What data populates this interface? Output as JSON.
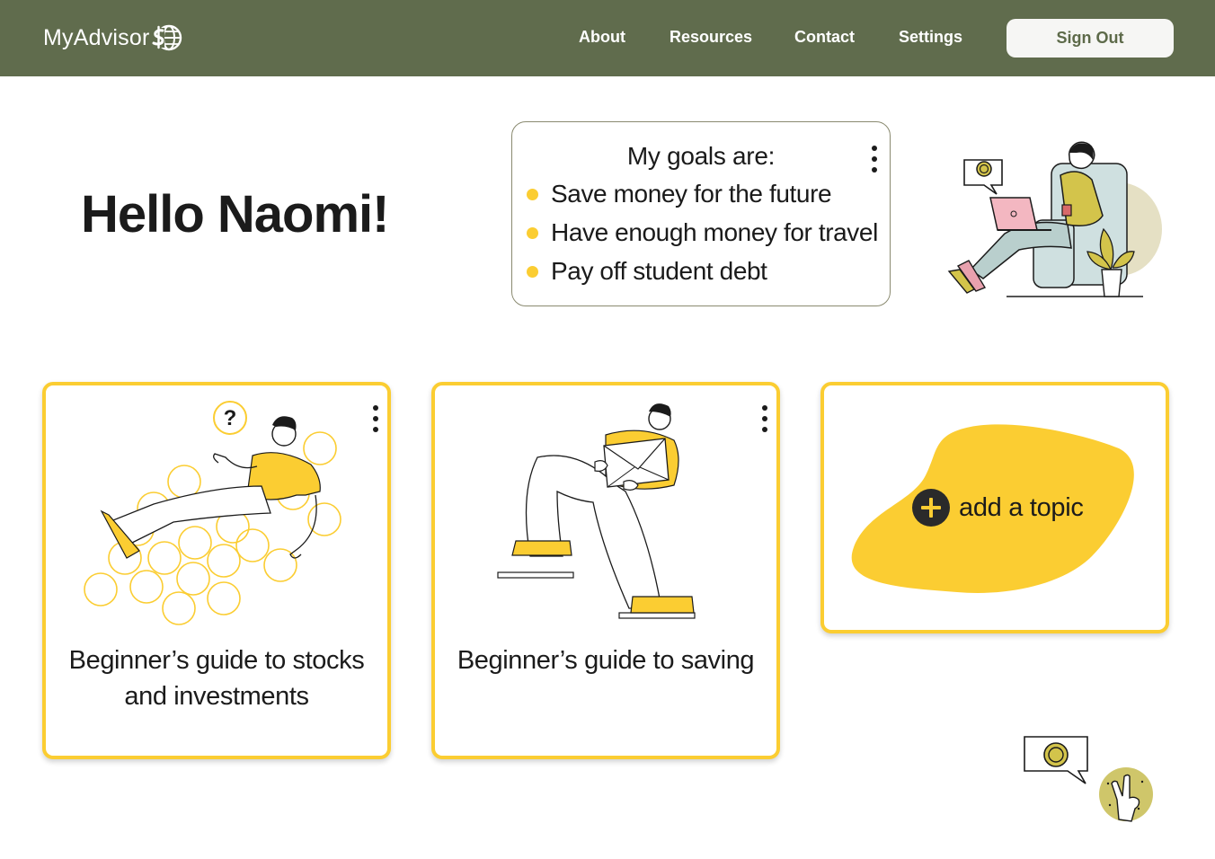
{
  "header": {
    "brand": "MyAdvisor",
    "nav": [
      "About",
      "Resources",
      "Contact",
      "Settings"
    ],
    "sign_out": "Sign Out"
  },
  "greeting": "Hello Naomi!",
  "goals": {
    "title": "My goals are:",
    "items": [
      "Save money for the future",
      "Have enough money for travel",
      "Pay off student debt"
    ]
  },
  "cards": [
    {
      "title_line1": "Beginner’s guide to stocks",
      "title_line2": "and investments"
    },
    {
      "title_line1": "Beginner’s guide to saving"
    }
  ],
  "add_topic": "add a topic",
  "colors": {
    "header": "#606c4d",
    "accent": "#fbcd32",
    "text": "#1b1b1b"
  }
}
